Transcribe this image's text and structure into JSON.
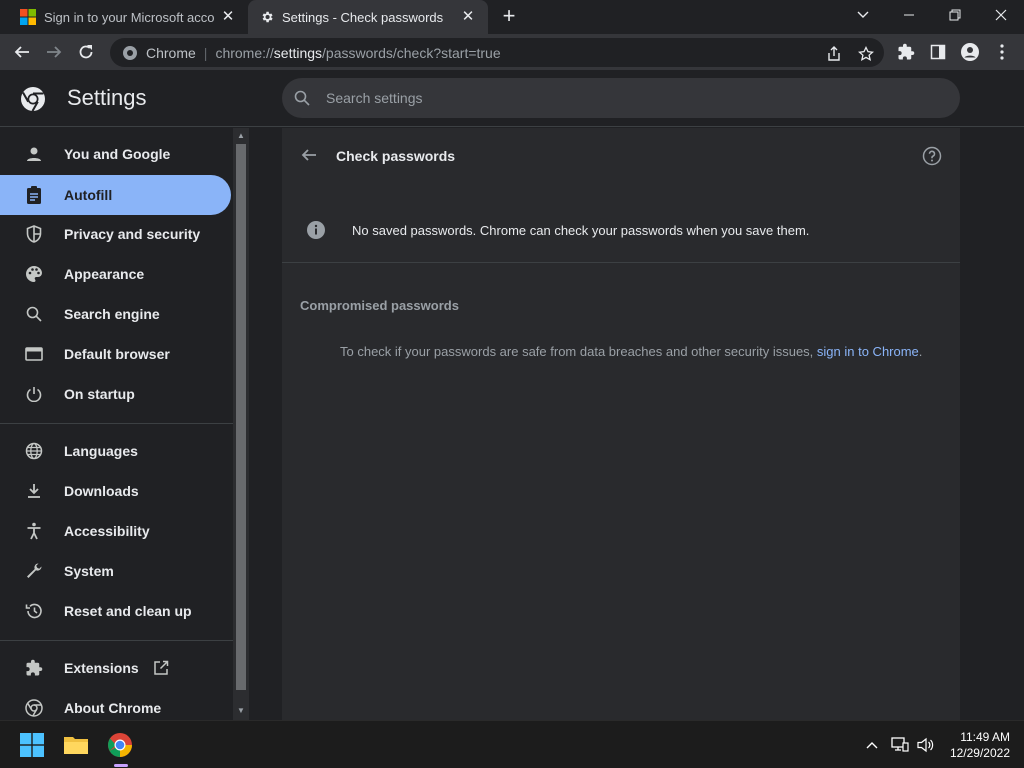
{
  "browser": {
    "tabs": [
      {
        "title": "Sign in to your Microsoft account",
        "active": false
      },
      {
        "title": "Settings - Check passwords",
        "active": true
      }
    ],
    "omnibox": {
      "chip": "Chrome",
      "url_prefix": "chrome://",
      "url_host": "settings",
      "url_path": "/passwords/check?start=true"
    }
  },
  "settings": {
    "title": "Settings",
    "search_placeholder": "Search settings",
    "nav": [
      {
        "label": "You and Google",
        "icon": "person-icon"
      },
      {
        "label": "Autofill",
        "icon": "clipboard-icon",
        "active": true
      },
      {
        "label": "Privacy and security",
        "icon": "shield-icon"
      },
      {
        "label": "Appearance",
        "icon": "palette-icon"
      },
      {
        "label": "Search engine",
        "icon": "search-icon"
      },
      {
        "label": "Default browser",
        "icon": "browser-icon"
      },
      {
        "label": "On startup",
        "icon": "power-icon"
      },
      {
        "label": "Languages",
        "icon": "globe-icon"
      },
      {
        "label": "Downloads",
        "icon": "download-icon"
      },
      {
        "label": "Accessibility",
        "icon": "accessibility-icon"
      },
      {
        "label": "System",
        "icon": "wrench-icon"
      },
      {
        "label": "Reset and clean up",
        "icon": "history-icon"
      },
      {
        "label": "Extensions",
        "icon": "puzzle-icon"
      },
      {
        "label": "About Chrome",
        "icon": "chrome-icon"
      }
    ]
  },
  "main": {
    "title": "Check passwords",
    "info_text": "No saved passwords. Chrome can check your passwords when you save them.",
    "section_heading": "Compromised passwords",
    "signin_text": "To check if your passwords are safe from data breaches and other security issues,",
    "signin_link": "sign in to Chrome",
    "signin_suffix": "."
  },
  "taskbar": {
    "time": "11:49 AM",
    "date": "12/29/2022"
  },
  "colors": {
    "accent": "#8ab4f8",
    "background": "#202124",
    "card": "#292a2d"
  }
}
